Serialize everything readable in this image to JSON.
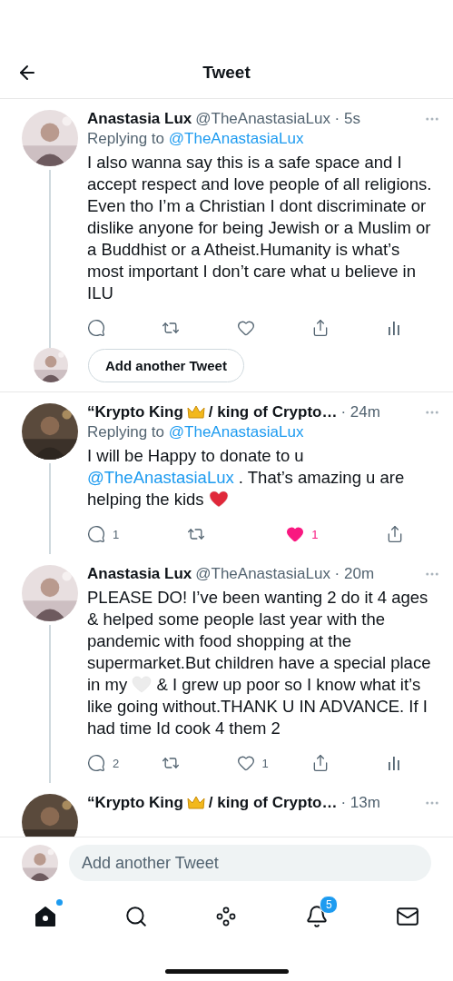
{
  "header": {
    "title": "Tweet"
  },
  "tweets": [
    {
      "avatar": {
        "kind": "picture"
      },
      "name": [
        {
          "kind": "text",
          "text": "Anastasia Lux"
        }
      ],
      "meta": "@TheAnastasiaLux · 5s",
      "replying_label": "Replying to",
      "replying_to": "@TheAnastasiaLux",
      "body": [
        {
          "kind": "text",
          "text": "I also wanna say this is a safe space and I accept respect and love people of all religions. Even tho I’m a Christian I dont discriminate or dislike anyone for being Jewish or a Muslim or a Buddhist or a Atheist.Humanity is what’s most important I don’t care what u believe in ILU"
        }
      ],
      "actions": [
        {
          "kind": "reply"
        },
        {
          "kind": "retweet"
        },
        {
          "kind": "like",
          "on": false
        },
        {
          "kind": "share"
        },
        {
          "kind": "stats"
        }
      ],
      "connected": true,
      "reply_prompt": {
        "label": "Add another Tweet"
      }
    },
    {
      "avatar": {
        "kind": "picture"
      },
      "name": [
        {
          "kind": "text",
          "text": "“Krypto King"
        },
        {
          "kind": "crown"
        },
        {
          "kind": "text",
          "text": "/ king of Crypto…"
        }
      ],
      "meta": "· 24m",
      "replying_label": "Replying to",
      "replying_to": "@TheAnastasiaLux",
      "body": [
        {
          "kind": "text",
          "text": "I will be Happy to donate to u "
        },
        {
          "kind": "link",
          "text": "@TheAnastasiaLux"
        },
        {
          "kind": "text",
          "text": " .  That’s amazing u are helping the kids "
        },
        {
          "kind": "heart",
          "color": "#e0283a"
        }
      ],
      "actions": [
        {
          "kind": "reply",
          "count": "1"
        },
        {
          "kind": "retweet"
        },
        {
          "kind": "like",
          "count": "1",
          "on": true
        },
        {
          "kind": "share"
        }
      ],
      "connected": true
    },
    {
      "avatar": {
        "kind": "picture"
      },
      "name": [
        {
          "kind": "text",
          "text": "Anastasia Lux"
        }
      ],
      "meta": "@TheAnastasiaLux · 20m",
      "body": [
        {
          "kind": "text",
          "text": "PLEASE DO! I’ve been wanting 2 do it 4 ages & helped some people last year with the pandemic with food shopping at the supermarket.But children have a special place in my "
        },
        {
          "kind": "heart",
          "color": "#ececec"
        },
        {
          "kind": "text",
          "text": "  & I grew up poor so I know what it’s like going without.THANK U IN ADVANCE. If I had time Id cook 4 them 2"
        }
      ],
      "actions": [
        {
          "kind": "reply",
          "count": "2"
        },
        {
          "kind": "retweet"
        },
        {
          "kind": "like",
          "count": "1",
          "on": false
        },
        {
          "kind": "share"
        },
        {
          "kind": "stats"
        }
      ],
      "connected": true
    },
    {
      "avatar": {
        "kind": "picture"
      },
      "name": [
        {
          "kind": "text",
          "text": "“Krypto King"
        },
        {
          "kind": "crown"
        },
        {
          "kind": "text",
          "text": "/ king of Crypto…"
        }
      ],
      "meta": "· 13m"
    }
  ],
  "composer": {
    "placeholder": "Add another Tweet"
  },
  "nav": [
    {
      "kind": "home",
      "selected": true,
      "dot": true
    },
    {
      "kind": "search",
      "selected": false
    },
    {
      "kind": "spaces",
      "selected": false
    },
    {
      "kind": "notifications",
      "selected": false,
      "badge": "5"
    },
    {
      "kind": "messages",
      "selected": false
    }
  ]
}
